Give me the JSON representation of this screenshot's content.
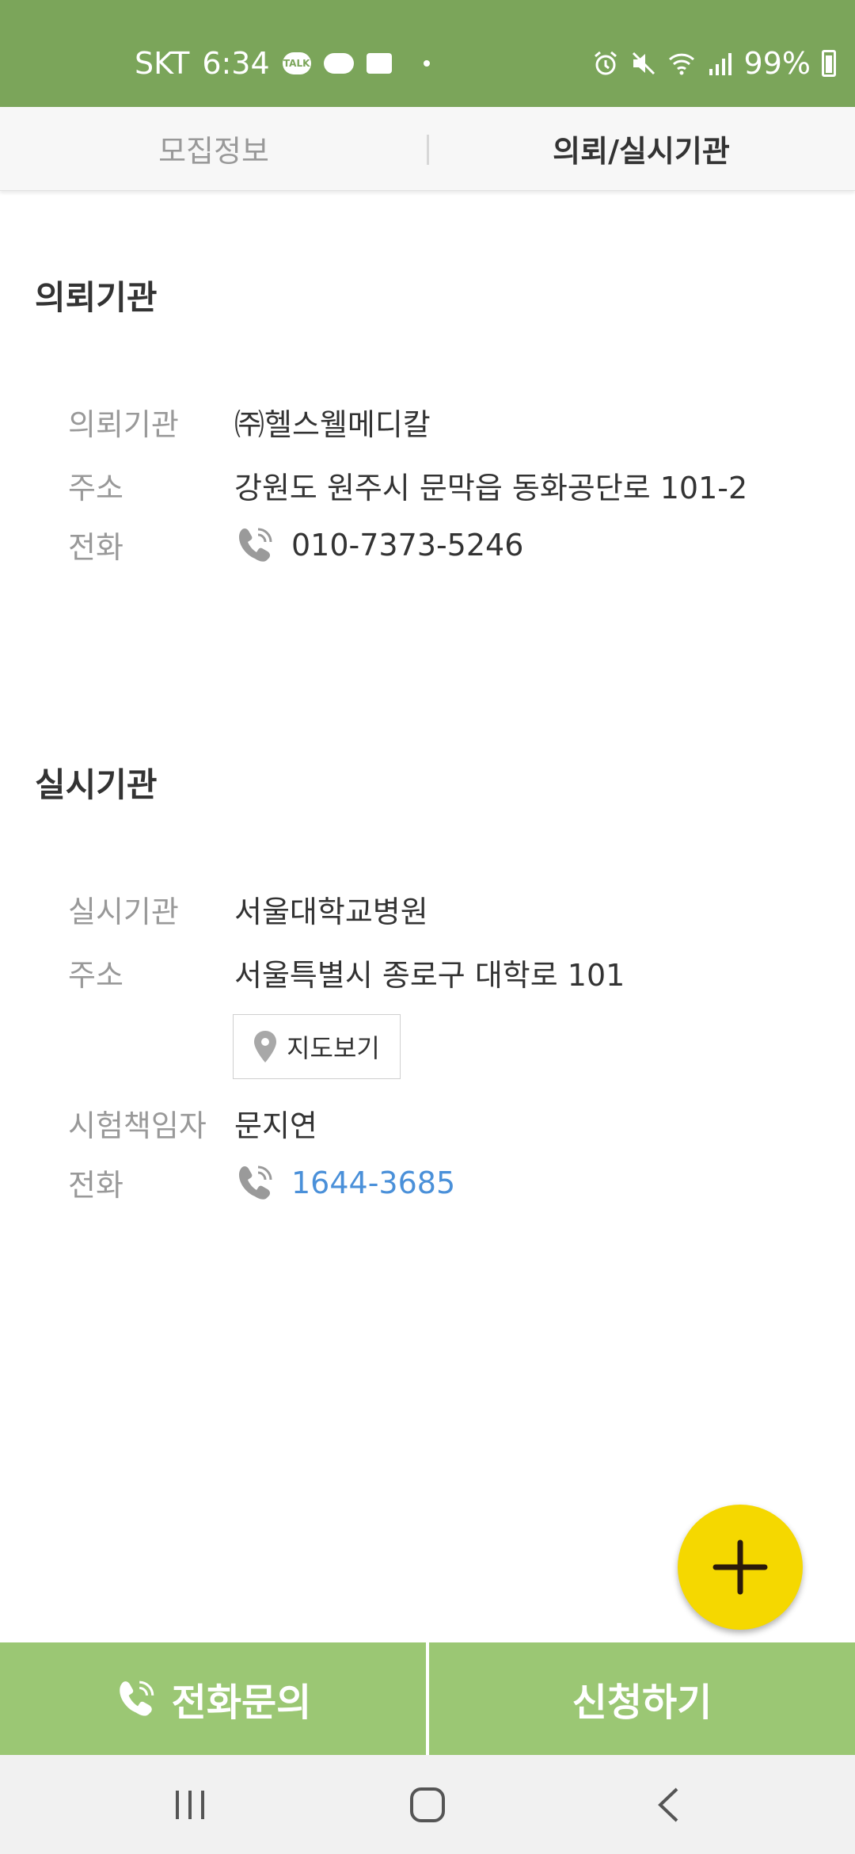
{
  "status_bar": {
    "carrier": "SKT",
    "time": "6:34",
    "talk_badge": "TALK",
    "battery": "99%"
  },
  "tabs": [
    {
      "label": "모집정보",
      "active": false
    },
    {
      "label": "의뢰/실시기관",
      "active": true
    }
  ],
  "requesting": {
    "title": "의뢰기관",
    "rows": [
      {
        "label": "의뢰기관",
        "value": "㈜헬스웰메디칼"
      },
      {
        "label": "주소",
        "value": "강원도 원주시 문막읍 동화공단로 101-2"
      },
      {
        "label": "전화",
        "value": "010-7373-5246"
      }
    ]
  },
  "performing": {
    "title": "실시기관",
    "rows": [
      {
        "label": "실시기관",
        "value": "서울대학교병원"
      },
      {
        "label": "주소",
        "value": "서울특별시 종로구 대학로 101"
      },
      {
        "label": "시험책임자",
        "value": "문지연"
      },
      {
        "label": "전화",
        "value": "1644-3685"
      }
    ],
    "map_button": "지도보기"
  },
  "fab_icon": "plus-icon",
  "bottom_bar": {
    "call_label": "전화문의",
    "apply_label": "신청하기"
  },
  "colors": {
    "status_bar": "#7ba55a",
    "bottom_bar": "#9bc774",
    "fab": "#f5d800",
    "link": "#4a90d9"
  }
}
